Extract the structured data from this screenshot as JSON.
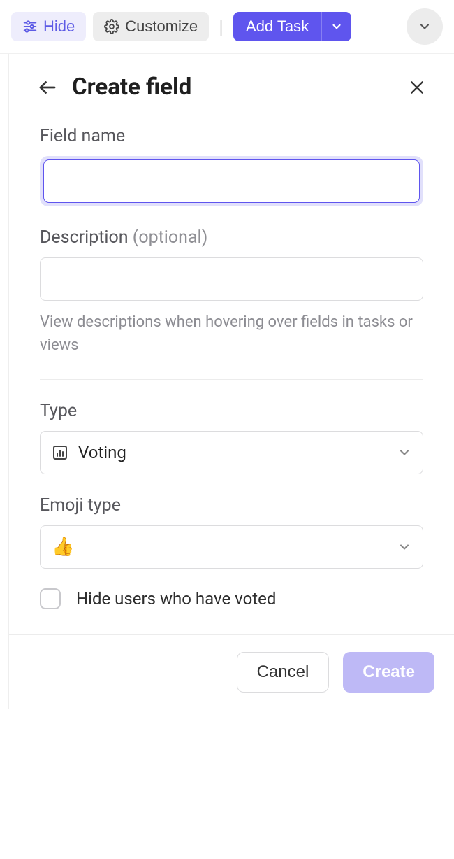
{
  "toolbar": {
    "hide_label": "Hide",
    "customize_label": "Customize",
    "add_task_label": "Add Task"
  },
  "panel": {
    "title": "Create field",
    "fields": {
      "name": {
        "label": "Field name",
        "value": ""
      },
      "description": {
        "label": "Description ",
        "optional": "(optional)",
        "value": "",
        "helper": "View descriptions when hovering over fields in tasks or views"
      },
      "type": {
        "label": "Type",
        "value": "Voting"
      },
      "emoji_type": {
        "label": "Emoji type",
        "value": "👍"
      },
      "hide_users": {
        "label": "Hide users who have voted",
        "checked": false
      }
    },
    "footer": {
      "cancel": "Cancel",
      "create": "Create"
    }
  }
}
